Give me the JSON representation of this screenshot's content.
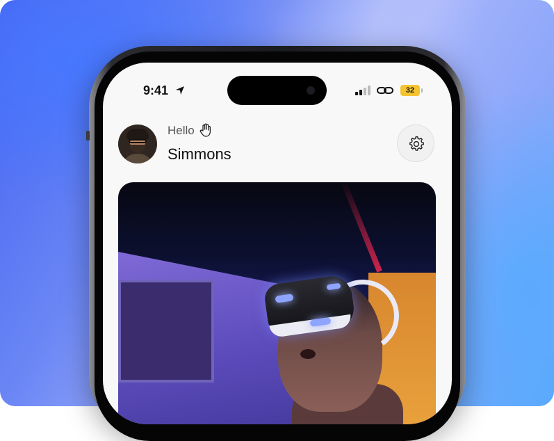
{
  "status_bar": {
    "time": "9:41",
    "battery": "32",
    "icons": [
      "location-arrow-icon",
      "signal-icon",
      "link-icon",
      "battery-icon"
    ]
  },
  "header": {
    "greeting": "Hello",
    "name": "Simmons",
    "greeting_icon": "wave-hand-icon",
    "settings_icon": "gear-icon"
  },
  "colors": {
    "battery": "#f4c430",
    "screen_bg": "#f8f8f8"
  }
}
